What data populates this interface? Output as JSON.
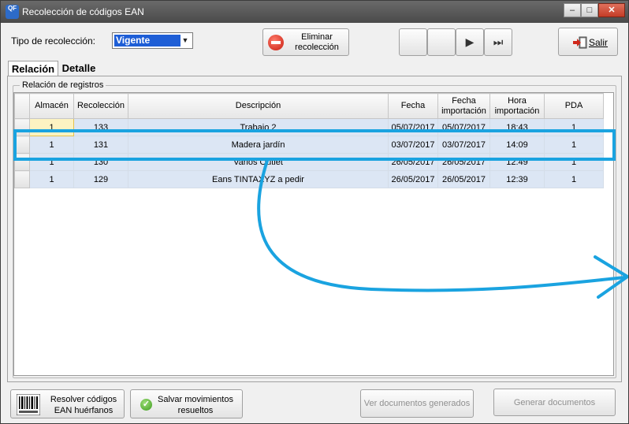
{
  "window": {
    "title": "Recolección de códigos EAN",
    "app_icon_text": "QF",
    "controls": {
      "minimize": "–",
      "maximize": "□",
      "close": "✕"
    }
  },
  "filter": {
    "label": "Tipo de recolección:",
    "selected": "Vigente",
    "dropdown_icon": "chevron-down-icon"
  },
  "toolbar": {
    "eliminar_label_1": "Eliminar",
    "eliminar_label_2": "recolección",
    "nav_buttons": [
      "",
      "",
      "▶",
      "⏭"
    ],
    "salir_label": "Salir"
  },
  "tabs": [
    "Relación",
    "Detalle"
  ],
  "group_label": "Relación de registros",
  "table": {
    "columns": [
      {
        "l1": "",
        "l2": ""
      },
      {
        "l1": "Almacén",
        "l2": ""
      },
      {
        "l1": "Recolección",
        "l2": ""
      },
      {
        "l1": "Descripción",
        "l2": ""
      },
      {
        "l1": "Fecha",
        "l2": ""
      },
      {
        "l1": "Fecha",
        "l2": "importación"
      },
      {
        "l1": "Hora",
        "l2": "importación"
      },
      {
        "l1": "PDA",
        "l2": ""
      }
    ],
    "rows": [
      [
        "1",
        "133",
        "Trabajo 2",
        "05/07/2017",
        "05/07/2017",
        "18:43",
        "1"
      ],
      [
        "1",
        "131",
        "Madera jardín",
        "03/07/2017",
        "03/07/2017",
        "14:09",
        "1"
      ],
      [
        "1",
        "130",
        "Varios Outlet",
        "26/05/2017",
        "26/05/2017",
        "12:49",
        "1"
      ],
      [
        "1",
        "129",
        "Eans TINTAXYZ a pedir",
        "26/05/2017",
        "26/05/2017",
        "12:39",
        "1"
      ]
    ]
  },
  "footer": {
    "resolver_1": "Resolver códigos",
    "resolver_2": "EAN huérfanos",
    "salvar_1": "Salvar movimientos",
    "salvar_2": "resueltos",
    "ver_documentos": "Ver documentos generados",
    "generar_documentos": "Generar documentos"
  },
  "colors": {
    "selection": "#1e5ed6",
    "row_fill": "#dce6f4",
    "annotation": "#1aa3e0"
  }
}
